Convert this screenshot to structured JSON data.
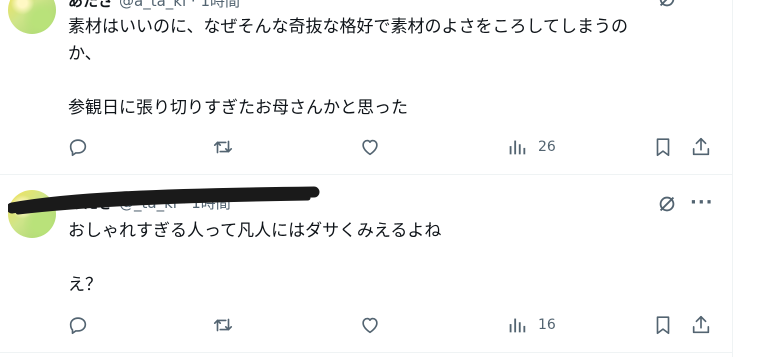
{
  "tweets": [
    {
      "name": "あたさ",
      "handle": "@a_ta_ki · 1時間",
      "lines": [
        "素材はいいのに、なぜそんな奇抜な格好で素材のよさをころしてしまうの",
        "か、",
        "",
        "参観日に張り切りすぎたお母さんかと思った"
      ],
      "views": "26"
    },
    {
      "name": "あたき",
      "handle": "@_ta_ki · 1時間",
      "lines": [
        "おしゃれすぎる人って凡人にはダサくみえるよね",
        "",
        "え？"
      ],
      "views": "16"
    }
  ],
  "icons": {
    "reply": "reply-icon",
    "retweet": "retweet-icon",
    "like": "like-icon",
    "views": "views-icon",
    "bookmark": "bookmark-icon",
    "share": "share-icon",
    "grok": "grok-icon",
    "more": "more-icon"
  },
  "colors": {
    "icon": "#536471",
    "text": "#0f1419",
    "divider": "#eff3f4"
  }
}
